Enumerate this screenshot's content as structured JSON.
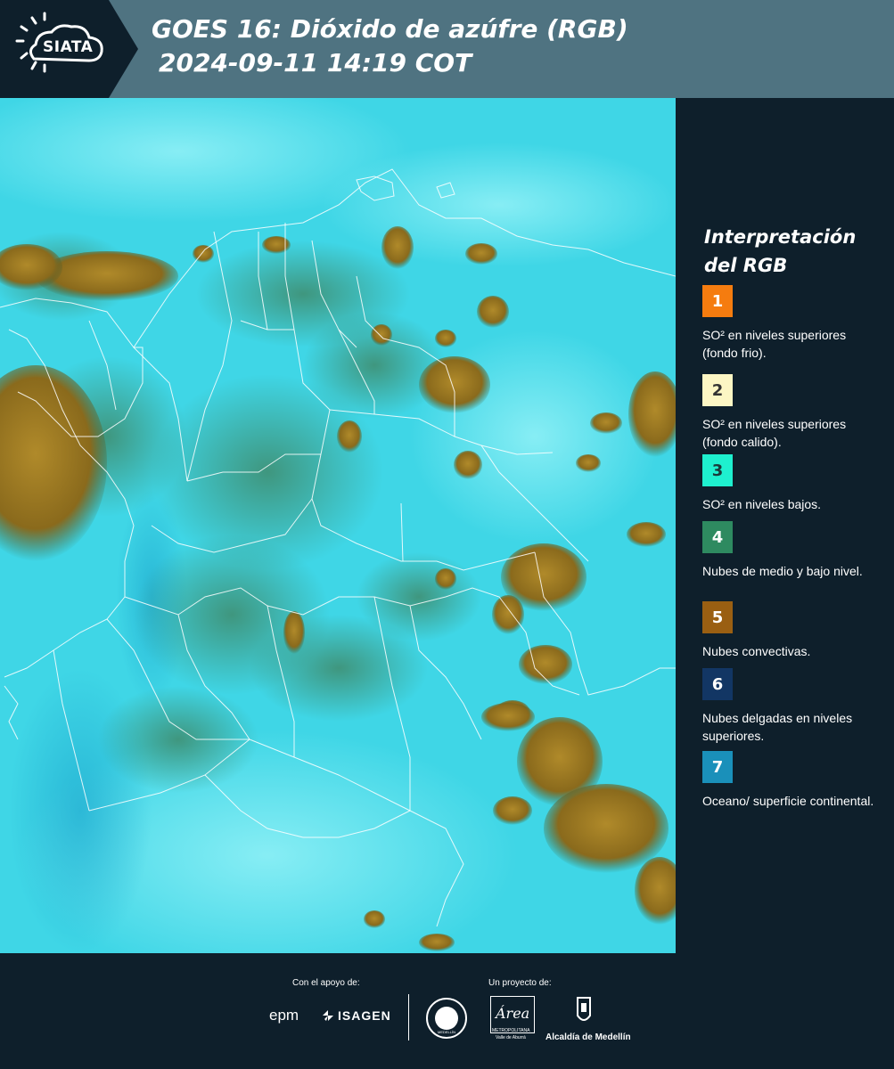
{
  "header": {
    "logo_text": "SIATA",
    "title_line1": "GOES 16: Dióxido de azúfre (RGB)",
    "title_line2": "2024-09-11 14:19 COT"
  },
  "legend": {
    "title_line1": "Interpretación",
    "title_line2": "del RGB",
    "items": [
      {
        "number": "1",
        "color": "#f57c0f",
        "text_color": "#ffffff",
        "description": "SO² en niveles superiores (fondo frio)."
      },
      {
        "number": "2",
        "color": "#fcf6c4",
        "text_color": "#333333",
        "description": "SO² en niveles superiores (fondo calido)."
      },
      {
        "number": "3",
        "color": "#1ef0cf",
        "text_color": "#1a3a3a",
        "description": "SO² en niveles bajos."
      },
      {
        "number": "4",
        "color": "#2e8a60",
        "text_color": "#ffffff",
        "description": "Nubes de medio y bajo nivel."
      },
      {
        "number": "5",
        "color": "#9a5f12",
        "text_color": "#ffffff",
        "description": "Nubes convectivas."
      },
      {
        "number": "6",
        "color": "#123664",
        "text_color": "#ffffff",
        "description": "Nubes delgadas en niveles superiores."
      },
      {
        "number": "7",
        "color": "#1a90ba",
        "text_color": "#ffffff",
        "description": "Oceano/ superficie continental."
      }
    ]
  },
  "footer": {
    "support_label": "Con el apoyo de:",
    "project_label": "Un proyecto de:",
    "sponsor_epm": "epm",
    "sponsor_isagen": "ISAGEN",
    "seal_text": "MEDELLÍN",
    "area_logo_word": "Área",
    "area_metro_text": "METROPOLITANA",
    "area_valle_text": "Valle de Aburrá",
    "alcaldia_text": "Alcaldía de Medellín"
  }
}
